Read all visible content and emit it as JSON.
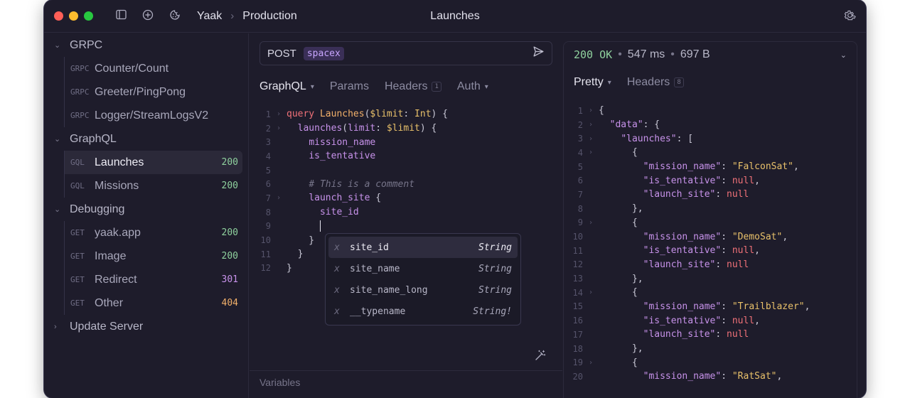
{
  "titlebar": {
    "workspace": "Yaak",
    "environment": "Production",
    "title": "Launches",
    "icons": [
      "sidebar-toggle-icon",
      "plus-circle-icon",
      "cookie-icon",
      "gear-icon"
    ]
  },
  "sidebar": {
    "folders": [
      {
        "label": "GRPC",
        "items": [
          {
            "method": "GRPC",
            "name": "Counter/Count",
            "code": ""
          },
          {
            "method": "GRPC",
            "name": "Greeter/PingPong",
            "code": ""
          },
          {
            "method": "GRPC",
            "name": "Logger/StreamLogsV2",
            "code": ""
          }
        ]
      },
      {
        "label": "GraphQL",
        "items": [
          {
            "method": "GQL",
            "name": "Launches",
            "code": "200"
          },
          {
            "method": "GQL",
            "name": "Missions",
            "code": "200"
          }
        ]
      },
      {
        "label": "Debugging",
        "items": [
          {
            "method": "GET",
            "name": "yaak.app",
            "code": "200"
          },
          {
            "method": "GET",
            "name": "Image",
            "code": "200"
          },
          {
            "method": "GET",
            "name": "Redirect",
            "code": "301"
          },
          {
            "method": "GET",
            "name": "Other",
            "code": "404"
          }
        ]
      },
      {
        "label": "Update Server",
        "items": []
      }
    ]
  },
  "request": {
    "method": "POST",
    "url_variable": "spacex",
    "tabs": [
      {
        "label": "GraphQL",
        "count": ""
      },
      {
        "label": "Params",
        "count": ""
      },
      {
        "label": "Headers",
        "count": "1"
      },
      {
        "label": "Auth",
        "count": ""
      }
    ],
    "variables_label": "Variables"
  },
  "editor": {
    "line_numbers": [
      "1",
      "2",
      "3",
      "4",
      "5",
      "6",
      "7",
      "8",
      "9",
      "10",
      "11",
      "12"
    ],
    "query": "query",
    "op_name": "Launches",
    "var_name": "$limit",
    "colon": ":",
    "type_name": "Int",
    "launches": "launches",
    "limit_arg": "limit",
    "fields": [
      "mission_name",
      "is_tentative",
      "launch_site",
      "site_id"
    ],
    "comment": "# This is a comment"
  },
  "autocomplete": [
    {
      "kind": "x",
      "label": "site_id",
      "type": "String"
    },
    {
      "kind": "x",
      "label": "site_name",
      "type": "String"
    },
    {
      "kind": "x",
      "label": "site_name_long",
      "type": "String"
    },
    {
      "kind": "x",
      "label": "__typename",
      "type": "String!"
    }
  ],
  "response": {
    "status": "200 OK",
    "time": "547 ms",
    "size": "697 B",
    "tabs": [
      {
        "label": "Pretty",
        "count": ""
      },
      {
        "label": "Headers",
        "count": "8"
      }
    ],
    "line_numbers": [
      "1",
      "2",
      "3",
      "4",
      "5",
      "6",
      "7",
      "8",
      "9",
      "10",
      "11",
      "12",
      "13",
      "14",
      "15",
      "16",
      "17",
      "18",
      "19",
      "20"
    ],
    "keys": {
      "data": "\"data\"",
      "launches": "\"launches\"",
      "mission_name": "\"mission_name\"",
      "is_tentative": "\"is_tentative\"",
      "launch_site": "\"launch_site\""
    },
    "null": "null",
    "missions": [
      "\"FalconSat\"",
      "\"DemoSat\"",
      "\"Trailblazer\"",
      "\"RatSat\""
    ]
  },
  "colors": {
    "accent": "#c792ea",
    "success": "#8fd19e",
    "warning": "#f2b06a",
    "background": "#1e1c2b"
  }
}
